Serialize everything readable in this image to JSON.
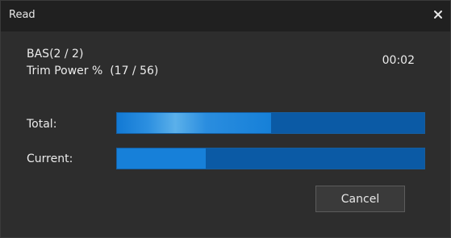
{
  "window": {
    "title": "Read",
    "close_icon": "close-icon"
  },
  "status": {
    "line1": "BAS(2 / 2)",
    "line2": "Trim Power %  (17 / 56)",
    "elapsed": "00:02"
  },
  "progress": {
    "total_label": "Total:",
    "total_fraction": 0.5,
    "current_label": "Current:",
    "current_fraction": 0.29
  },
  "buttons": {
    "cancel_label": "Cancel"
  },
  "colors": {
    "bar_track": "#0b5aa5",
    "bar_fill": "#1780d9",
    "titlebar": "#202020",
    "background": "#2d2d2d"
  }
}
